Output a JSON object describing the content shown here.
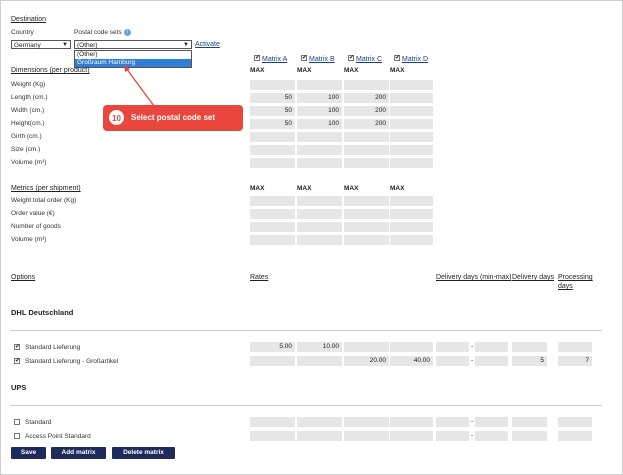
{
  "destination": {
    "heading": "Destination",
    "country_label": "Country",
    "country_value": "Germany",
    "postal_label": "Postal code sets",
    "postal_value": "(Other)",
    "postal_options": [
      "(Other)",
      "Großraum Hamburg"
    ],
    "activate": "Activate"
  },
  "matrices": [
    "Matrix A",
    "Matrix B",
    "Matrix C",
    "Matrix D"
  ],
  "max_label": "MAX",
  "dimensions": {
    "heading": "Dimensions (per product)",
    "rows": [
      {
        "label": "Weight (Kg)",
        "values": [
          "",
          "",
          "",
          ""
        ]
      },
      {
        "label": "Length (cm.)",
        "values": [
          "50",
          "100",
          "200",
          ""
        ]
      },
      {
        "label": "Width (cm.)",
        "values": [
          "50",
          "100",
          "200",
          ""
        ]
      },
      {
        "label": "Height(cm.)",
        "values": [
          "50",
          "100",
          "200",
          ""
        ]
      },
      {
        "label": "Girth (cm.)",
        "values": [
          "",
          "",
          "",
          ""
        ]
      },
      {
        "label": "Size (cm.)",
        "values": [
          "",
          "",
          "",
          ""
        ]
      },
      {
        "label": "Volume (m³)",
        "values": [
          "",
          "",
          "",
          ""
        ]
      }
    ]
  },
  "metrics": {
    "heading": "Metrics (per shipment)",
    "rows": [
      {
        "label": "Weight total order (Kg)"
      },
      {
        "label": "Order value (€)"
      },
      {
        "label": "Number of goods"
      },
      {
        "label": "Volume (m³)"
      }
    ]
  },
  "options_header": {
    "options": "Options",
    "rates": "Rates",
    "delivery_minmax": "Delivery days (min-max)",
    "delivery_days": "Delivery days",
    "processing": "Processing",
    "processing2": "days"
  },
  "carriers": [
    {
      "name": "DHL Deutschland",
      "items": [
        {
          "label": "Standard Lieferung",
          "checked": true,
          "rates": [
            "5.00",
            "10.00",
            "",
            ""
          ],
          "dmin": "",
          "dmax": "",
          "days": "",
          "proc": ""
        },
        {
          "label": "Standard Lieferung - Großartikel",
          "checked": true,
          "rates": [
            "",
            "",
            "20.00",
            "40.00"
          ],
          "dmin": "",
          "dmax": "",
          "days": "5",
          "proc": "7"
        }
      ]
    },
    {
      "name": "UPS",
      "items": [
        {
          "label": "Standard",
          "checked": false,
          "rates": [
            "",
            "",
            "",
            ""
          ],
          "dmin": "",
          "dmax": "",
          "days": "",
          "proc": ""
        },
        {
          "label": "Access Point Standard",
          "checked": false,
          "rates": [
            "",
            "",
            "",
            ""
          ],
          "dmin": "",
          "dmax": "",
          "days": "",
          "proc": ""
        }
      ]
    }
  ],
  "buttons": {
    "save": "Save",
    "add_matrix": "Add matrix",
    "delete_matrix": "Delete matrix"
  },
  "callout": {
    "number": "10",
    "text": "Select postal code set",
    "color": "#e9473e"
  }
}
